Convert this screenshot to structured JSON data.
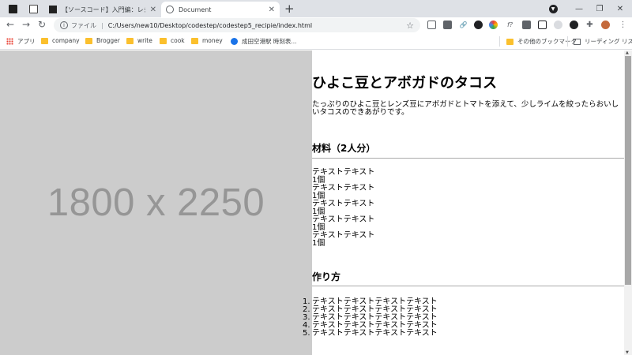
{
  "tabs": {
    "inactive_title": "【ソースコード】入門編：レシピサイト…",
    "active_title": "Document",
    "close_glyph": "✕",
    "new_tab_glyph": "+"
  },
  "window": {
    "minimize": "—",
    "restore": "❐",
    "close": "✕"
  },
  "toolbar": {
    "back": "←",
    "forward": "→",
    "reload": "↻",
    "scheme_label": "ファイル",
    "url": "C:/Users/new10/Desktop/codestep/codestep5_recipie/index.html",
    "star": "☆"
  },
  "bookmarks": {
    "items": [
      "アプリ",
      "company",
      "Brogger",
      "write",
      "cook",
      "money",
      "成田空港駅 時刻表..."
    ],
    "other": "その他のブックマーク",
    "reading_list": "リーディング リスト"
  },
  "page": {
    "placeholder": "1800 x 2250",
    "title": "ひよこ豆とアボガドのタコス",
    "intro": "たっぷりのひよこ豆とレンズ豆にアボガドとトマトを添えて、少しライムを絞ったらおいしいタコスのできあがりです。",
    "ingredients_heading": "材料（2人分）",
    "ingredients": [
      {
        "name": "テキストテキスト",
        "qty": "1個"
      },
      {
        "name": "テキストテキスト",
        "qty": "1個"
      },
      {
        "name": "テキストテキスト",
        "qty": "1個"
      },
      {
        "name": "テキストテキスト",
        "qty": "1個"
      },
      {
        "name": "テキストテキスト",
        "qty": "1個"
      }
    ],
    "steps_heading": "作り方",
    "steps": [
      {
        "num": "1.",
        "text": "テキストテキストテキストテキスト"
      },
      {
        "num": "2.",
        "text": "テキストテキストテキストテキスト"
      },
      {
        "num": "3.",
        "text": "テキストテキストテキストテキスト"
      },
      {
        "num": "4.",
        "text": "テキストテキストテキストテキスト"
      },
      {
        "num": "5.",
        "text": "テキストテキストテキストテキスト"
      }
    ]
  }
}
